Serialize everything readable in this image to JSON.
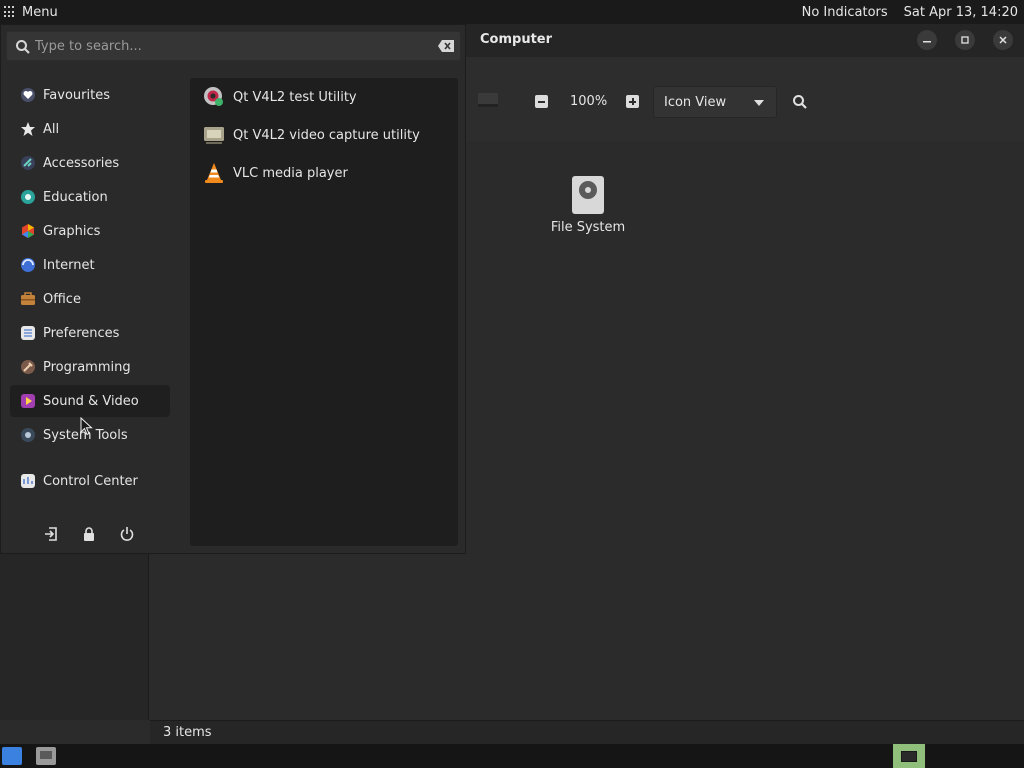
{
  "top_panel": {
    "menu_label": "Menu",
    "indicators": "No Indicators",
    "clock": "Sat Apr 13, 14:20"
  },
  "window": {
    "title": "Computer",
    "zoom": "100%",
    "view_mode": "Icon View",
    "items": [
      {
        "label": "File System",
        "icon": "drive-icon"
      }
    ],
    "status": "3 items"
  },
  "menu": {
    "search_placeholder": "Type to search...",
    "categories": [
      {
        "label": "Favourites",
        "icon": "favourites-icon"
      },
      {
        "label": "All",
        "icon": "star-icon"
      },
      {
        "label": "Accessories",
        "icon": "accessories-icon"
      },
      {
        "label": "Education",
        "icon": "education-icon"
      },
      {
        "label": "Graphics",
        "icon": "graphics-icon"
      },
      {
        "label": "Internet",
        "icon": "internet-icon"
      },
      {
        "label": "Office",
        "icon": "office-icon"
      },
      {
        "label": "Preferences",
        "icon": "preferences-icon"
      },
      {
        "label": "Programming",
        "icon": "programming-icon"
      },
      {
        "label": "Sound & Video",
        "icon": "sound-video-icon",
        "active": true
      },
      {
        "label": "System Tools",
        "icon": "system-tools-icon"
      },
      {
        "label": "Control Center",
        "icon": "control-center-icon"
      }
    ],
    "apps": [
      {
        "label": "Qt V4L2 test Utility",
        "icon": "qv4l2-icon"
      },
      {
        "label": "Qt V4L2 video capture utility",
        "icon": "video-capture-icon"
      },
      {
        "label": "VLC media player",
        "icon": "vlc-icon"
      }
    ],
    "system_buttons": [
      "logout-icon",
      "lock-icon",
      "power-icon"
    ]
  },
  "colors": {
    "accent_blue": "#3b82e0",
    "window_bg": "#2b2b2b",
    "menu_bg": "#2a2a2a",
    "apps_panel_bg": "#1e1e1e"
  }
}
